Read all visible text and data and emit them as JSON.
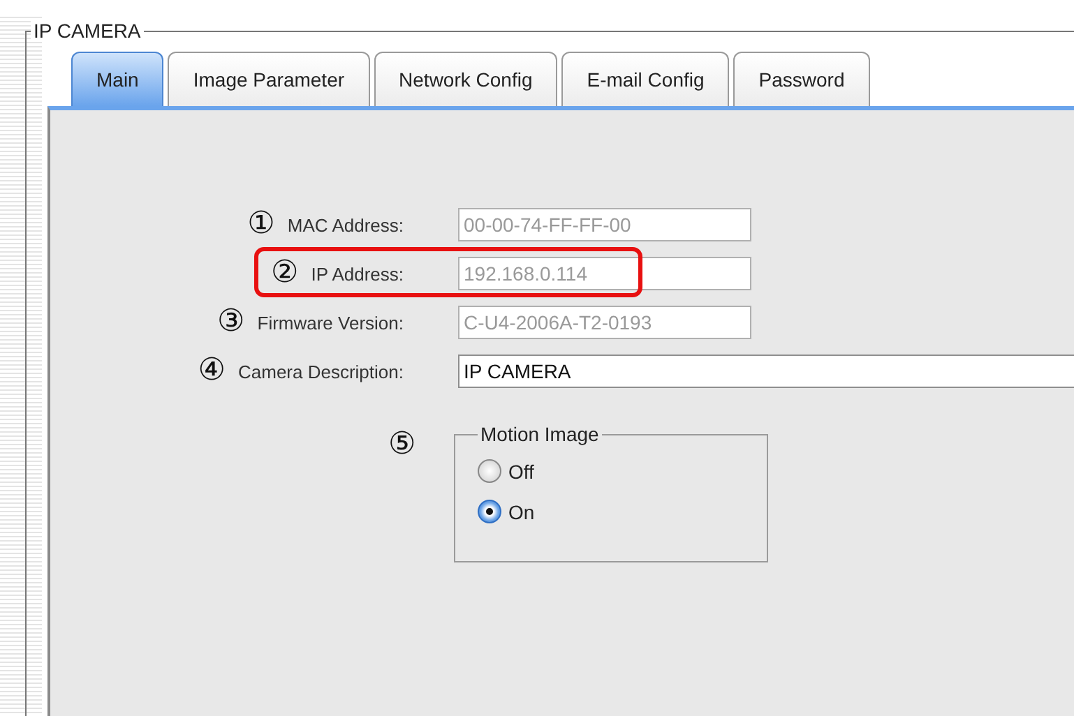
{
  "group": {
    "title": "IP CAMERA"
  },
  "tabs": [
    {
      "label": "Main",
      "selected": true
    },
    {
      "label": "Image Parameter",
      "selected": false
    },
    {
      "label": "Network Config",
      "selected": false
    },
    {
      "label": "E-mail Config",
      "selected": false
    },
    {
      "label": "Password",
      "selected": false
    }
  ],
  "fields": [
    {
      "number": "①",
      "label": "MAC Address:",
      "value": "00-00-74-FF-FF-00",
      "kind": "short",
      "disabled": true,
      "highlighted": false
    },
    {
      "number": "②",
      "label": "IP Address:",
      "value": "192.168.0.114",
      "kind": "short",
      "disabled": true,
      "highlighted": true
    },
    {
      "number": "③",
      "label": "Firmware Version:",
      "value": "C-U4-2006A-T2-0193",
      "kind": "short",
      "disabled": true,
      "highlighted": false
    },
    {
      "number": "④",
      "label": "Camera Description:",
      "value": "IP CAMERA",
      "kind": "wide",
      "disabled": false,
      "highlighted": false
    }
  ],
  "motion": {
    "number": "⑤",
    "title": "Motion Image",
    "options": [
      {
        "label": "Off",
        "selected": false
      },
      {
        "label": "On",
        "selected": true
      }
    ]
  }
}
